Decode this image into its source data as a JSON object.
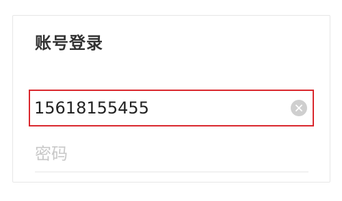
{
  "login": {
    "title": "账号登录",
    "phone": {
      "value": "15618155455",
      "clear_icon": "clear-circle-icon"
    },
    "password": {
      "placeholder": "密码",
      "value": ""
    }
  },
  "colors": {
    "focus_border": "#d9262c",
    "title_text": "#333333",
    "placeholder": "#c8c8c8",
    "divider": "#e6e6e6",
    "clear_button": "#cfcfcf"
  }
}
